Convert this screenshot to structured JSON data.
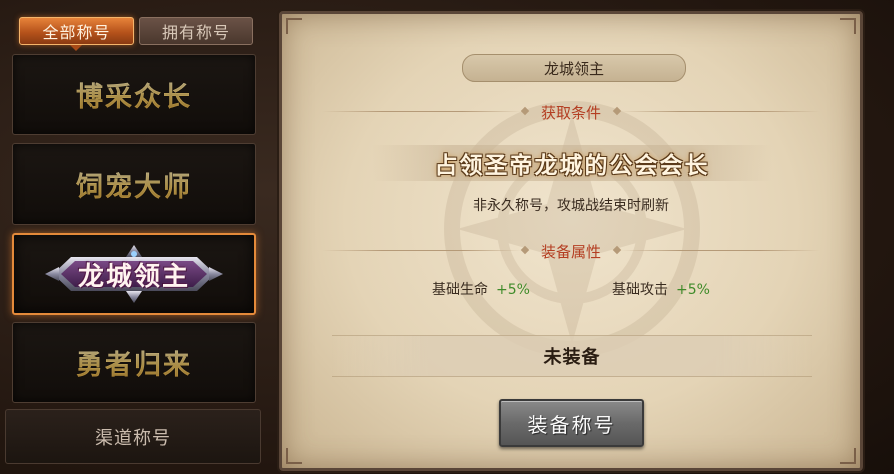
{
  "tabs": {
    "all_titles": "全部称号",
    "owned_titles": "拥有称号"
  },
  "title_list": [
    {
      "label": "博采众长"
    },
    {
      "label": "饲宠大师"
    },
    {
      "label": "龙城领主",
      "selected": true
    },
    {
      "label": "勇者归来"
    }
  ],
  "channel_titles": "渠道称号",
  "detail": {
    "title_name": "龙城领主",
    "acquire_section": "获取条件",
    "condition": "占领圣帝龙城的公会会长",
    "condition_note": "非永久称号，攻城战结束时刷新",
    "attr_section": "装备属性",
    "attributes": [
      {
        "name": "基础生命",
        "value": "+5%"
      },
      {
        "name": "基础攻击",
        "value": "+5%"
      }
    ],
    "status": "未装备",
    "equip_button": "装备称号"
  },
  "colors": {
    "accent_orange": "#d86a28",
    "title_gold": "#f2c862",
    "section_red": "#b43e22",
    "positive_green": "#3f8b2a"
  }
}
